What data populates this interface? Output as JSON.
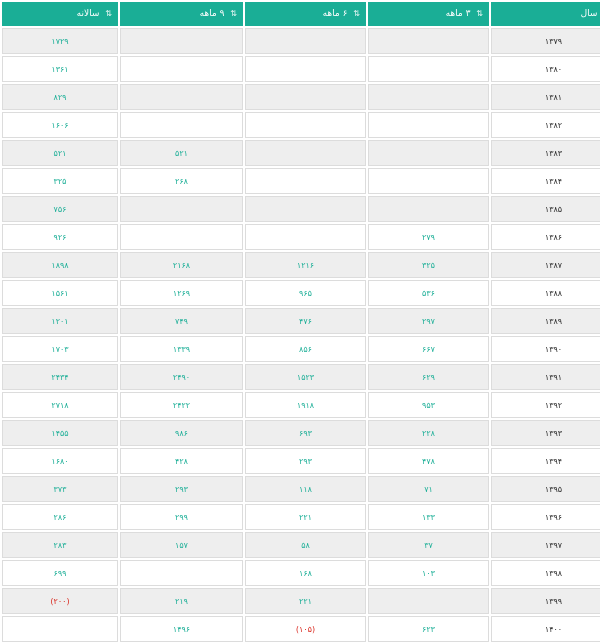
{
  "headers": [
    {
      "label": "سال",
      "sort_icon": "sort-icon"
    },
    {
      "label": "۳ ماهه",
      "sort_icon": "sort-icon"
    },
    {
      "label": "۶ ماهه",
      "sort_icon": "sort-icon"
    },
    {
      "label": "۹ ماهه",
      "sort_icon": "sort-icon"
    },
    {
      "label": "سالانه",
      "sort_icon": "sort-icon"
    }
  ],
  "rows": [
    {
      "year": "۱۳۷۹",
      "q3": "",
      "q6": "",
      "q9": "",
      "annual": "۱۷۲۹"
    },
    {
      "year": "۱۳۸۰",
      "q3": "",
      "q6": "",
      "q9": "",
      "annual": "۱۳۶۱"
    },
    {
      "year": "۱۳۸۱",
      "q3": "",
      "q6": "",
      "q9": "",
      "annual": "۸۲۹"
    },
    {
      "year": "۱۳۸۲",
      "q3": "",
      "q6": "",
      "q9": "",
      "annual": "۱۶۰۶"
    },
    {
      "year": "۱۳۸۳",
      "q3": "",
      "q6": "",
      "q9": "۵۲۱",
      "annual": "۵۲۱"
    },
    {
      "year": "۱۳۸۴",
      "q3": "",
      "q6": "",
      "q9": "۲۶۸",
      "annual": "۳۲۵"
    },
    {
      "year": "۱۳۸۵",
      "q3": "",
      "q6": "",
      "q9": "",
      "annual": "۷۵۶"
    },
    {
      "year": "۱۳۸۶",
      "q3": "۲۷۹",
      "q6": "",
      "q9": "",
      "annual": "۹۲۶"
    },
    {
      "year": "۱۳۸۷",
      "q3": "۳۲۵",
      "q6": "۱۲۱۶",
      "q9": "۲۱۶۸",
      "annual": "۱۸۹۸"
    },
    {
      "year": "۱۳۸۸",
      "q3": "۵۳۶",
      "q6": "۹۶۵",
      "q9": "۱۲۶۹",
      "annual": "۱۵۶۱"
    },
    {
      "year": "۱۳۸۹",
      "q3": "۲۹۷",
      "q6": "۴۷۶",
      "q9": "۷۴۹",
      "annual": "۱۲۰۱"
    },
    {
      "year": "۱۳۹۰",
      "q3": "۶۶۷",
      "q6": "۸۵۶",
      "q9": "۱۳۳۹",
      "annual": "۱۷۰۳"
    },
    {
      "year": "۱۳۹۱",
      "q3": "۶۲۹",
      "q6": "۱۵۲۳",
      "q9": "۲۴۹۰",
      "annual": "۲۴۳۴"
    },
    {
      "year": "۱۳۹۲",
      "q3": "۹۵۳",
      "q6": "۱۹۱۸",
      "q9": "۲۴۲۲",
      "annual": "۲۷۱۸"
    },
    {
      "year": "۱۳۹۳",
      "q3": "۲۲۸",
      "q6": "۶۹۳",
      "q9": "۹۸۶",
      "annual": "۱۴۵۵"
    },
    {
      "year": "۱۳۹۴",
      "q3": "۴۷۸",
      "q6": "۲۹۳",
      "q9": "۴۲۸",
      "annual": "۱۶۸۰"
    },
    {
      "year": "۱۳۹۵",
      "q3": "۷۱",
      "q6": "۱۱۸",
      "q9": "۲۹۳",
      "annual": "۳۷۳"
    },
    {
      "year": "۱۳۹۶",
      "q3": "۱۳۳",
      "q6": "۲۲۱",
      "q9": "۲۹۹",
      "annual": "۲۸۶"
    },
    {
      "year": "۱۳۹۷",
      "q3": "۳۷",
      "q6": "۵۸",
      "q9": "۱۵۷",
      "annual": "۲۸۳"
    },
    {
      "year": "۱۳۹۸",
      "q3": "۱۰۳",
      "q6": "۱۶۸",
      "q9": "",
      "annual": "۶۹۹"
    },
    {
      "year": "۱۳۹۹",
      "q3": "",
      "q6": "۲۲۱",
      "q9": "۲۱۹",
      "annual": "(۲۰۰)"
    },
    {
      "year": "۱۴۰۰",
      "q3": "۶۲۳",
      "q6": "(۱۰۵)",
      "q9": "۱۴۹۶",
      "annual": ""
    }
  ],
  "colors": {
    "header_bg": "#1aae96",
    "value_text": "#1aae96",
    "negative_text": "#d9261c",
    "stripe_bg": "#eeeeee"
  }
}
